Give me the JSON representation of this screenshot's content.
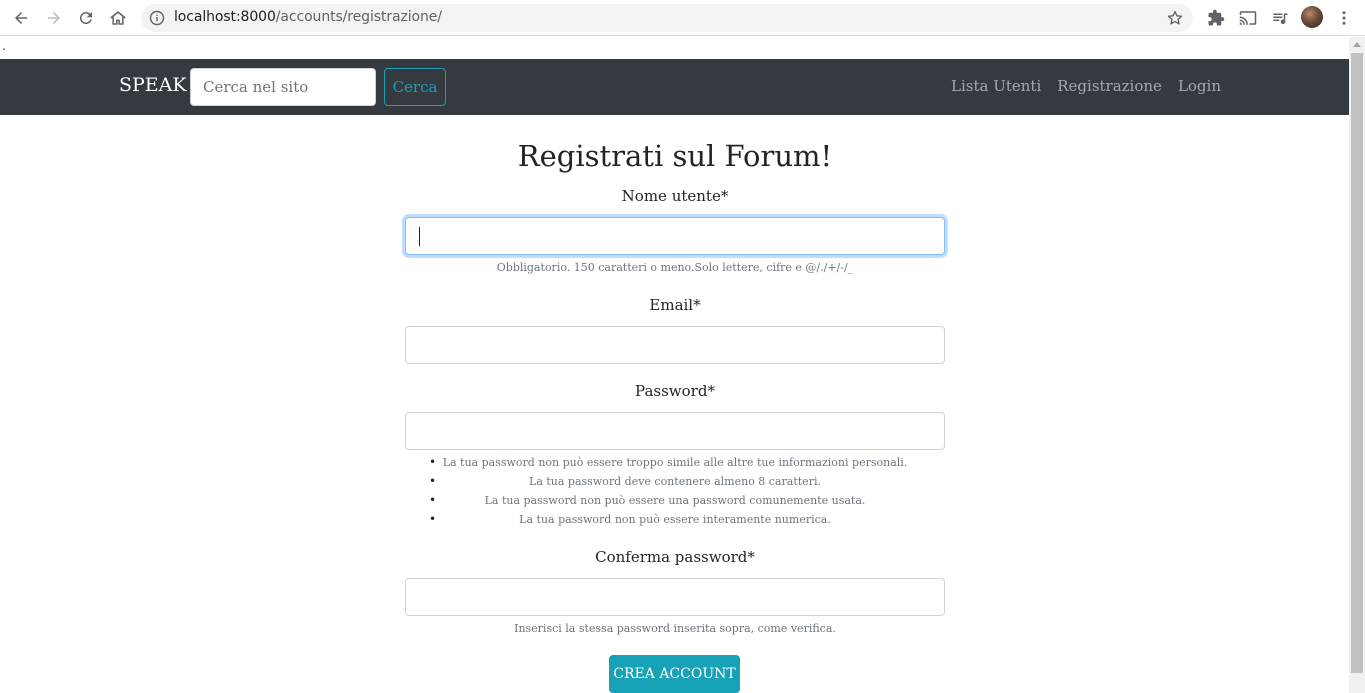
{
  "browser": {
    "url_host": "localhost:8000",
    "url_path": "/accounts/registrazione/"
  },
  "page": {
    "stray_text": "."
  },
  "navbar": {
    "brand": "SPEAK",
    "search_placeholder": "Cerca nel sito",
    "search_button": "Cerca",
    "links": [
      "Lista Utenti",
      "Registrazione",
      "Login"
    ]
  },
  "form": {
    "title": "Registrati sul Forum!",
    "username": {
      "label": "Nome utente*",
      "value": "",
      "help": "Obbligatorio. 150 caratteri o meno.Solo lettere, cifre e @/./+/-/_"
    },
    "email": {
      "label": "Email*",
      "value": ""
    },
    "password": {
      "label": "Password*",
      "value": "",
      "rules": [
        "La tua password non può essere troppo simile alle altre tue informazioni personali.",
        "La tua password deve contenere almeno 8 caratteri.",
        "La tua password non può essere una password comunemente usata.",
        "La tua password non può essere interamente numerica."
      ]
    },
    "confirm": {
      "label": "Conferma password*",
      "value": "",
      "help": "Inserisci la stessa password inserita sopra, come verifica."
    },
    "submit": "CREA ACCOUNT"
  },
  "colors": {
    "navbar_bg": "#343a40",
    "accent": "#17a2b8"
  }
}
